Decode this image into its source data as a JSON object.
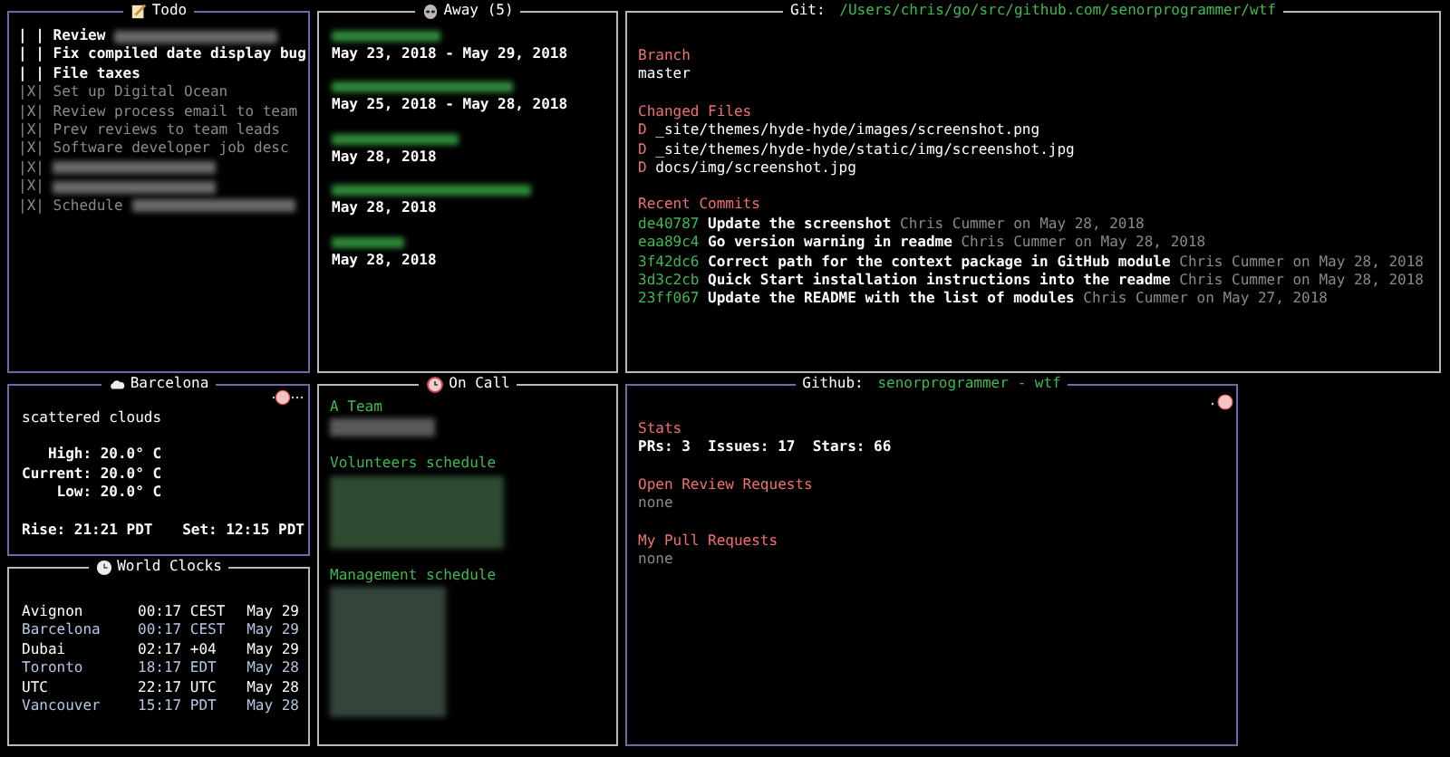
{
  "todo": {
    "title": "Todo",
    "focusable": true,
    "items": [
      {
        "box": "| |",
        "text": "Review",
        "checked": false,
        "redacted": true
      },
      {
        "box": "| |",
        "text": "Fix compiled date display bug",
        "checked": false,
        "redacted": false
      },
      {
        "box": "| |",
        "text": "File taxes",
        "checked": false,
        "redacted": false
      },
      {
        "box": "|X|",
        "text": "Set up Digital Ocean",
        "checked": true,
        "redacted": false
      },
      {
        "box": "|X|",
        "text": "Review process email to team",
        "checked": true,
        "redacted": false
      },
      {
        "box": "|X|",
        "text": "Prev reviews to team leads",
        "checked": true,
        "redacted": false
      },
      {
        "box": "|X|",
        "text": "Software developer job desc",
        "checked": true,
        "redacted": false
      },
      {
        "box": "|X|",
        "checked": true,
        "redacted": true
      },
      {
        "box": "|X|",
        "checked": true,
        "redacted": true
      },
      {
        "box": "|X|",
        "text": "Schedule",
        "checked": true,
        "redacted": true
      }
    ]
  },
  "away": {
    "title": "Away (5)",
    "focusable": false,
    "entries": [
      {
        "date": "May 23, 2018 - May 29, 2018"
      },
      {
        "date": "May 25, 2018 - May 28, 2018"
      },
      {
        "date": "May 28, 2018"
      },
      {
        "date": "May 28, 2018"
      },
      {
        "date": "May 28, 2018"
      }
    ]
  },
  "git": {
    "title": "Git:",
    "path": "/Users/chris/go/src/github.com/senorprogrammer/wtf",
    "focusable": false,
    "branch_heading": "Branch",
    "branch": "master",
    "changed_heading": "Changed Files",
    "changed_files": [
      {
        "status": "D",
        "path": "_site/themes/hyde-hyde/images/screenshot.png"
      },
      {
        "status": "D",
        "path": "_site/themes/hyde-hyde/static/img/screenshot.jpg"
      },
      {
        "status": "D",
        "path": "docs/img/screenshot.jpg"
      }
    ],
    "commits_heading": "Recent Commits",
    "commits": [
      {
        "hash": "de40787",
        "message": "Update the screenshot",
        "author": "Chris Cummer on May 28, 2018"
      },
      {
        "hash": "eaa89c4",
        "message": "Go version warning in readme",
        "author": "Chris Cummer on May 28, 2018"
      },
      {
        "hash": "3f42dc6",
        "message": "Correct path for the context package in GitHub module",
        "author": "Chris Cummer on May 28, 2018"
      },
      {
        "hash": "3d3c2cb",
        "message": "Quick Start installation instructions into the readme",
        "author": "Chris Cummer on May 28, 2018"
      },
      {
        "hash": "23ff067",
        "message": "Update the README with the list of modules",
        "author": "Chris Cummer on May 27, 2018"
      }
    ]
  },
  "weather": {
    "title": "Barcelona",
    "focusable": true,
    "description": "scattered clouds",
    "readings": [
      "   High: 20.0° C",
      "Current: 20.0° C",
      "    Low: 20.0° C"
    ],
    "sunrise": "Rise: 21:21 PDT",
    "sunset": "Set: 12:15 PDT"
  },
  "world_clocks": {
    "title": "World Clocks",
    "focusable": false,
    "rows": [
      {
        "city": "Avignon",
        "time": "00:17 CEST",
        "date": "May 29"
      },
      {
        "city": "Barcelona",
        "time": "00:17 CEST",
        "date": "May 29"
      },
      {
        "city": "Dubai",
        "time": "02:17 +04",
        "date": "May 29"
      },
      {
        "city": "Toronto",
        "time": "18:17 EDT",
        "date": "May 28"
      },
      {
        "city": "UTC",
        "time": "22:17 UTC",
        "date": "May 28"
      },
      {
        "city": "Vancouver",
        "time": "15:17 PDT",
        "date": "May 28"
      }
    ]
  },
  "on_call": {
    "title": "On Call",
    "focusable": false,
    "schedules": [
      {
        "name": "A Team"
      },
      {
        "name": "Volunteers schedule"
      },
      {
        "name": "Management schedule"
      }
    ]
  },
  "github": {
    "title": "Github:",
    "repo": "senorprogrammer - wtf",
    "focusable": true,
    "stats_heading": "Stats",
    "stats": "PRs: 3  Issues: 17  Stars: 66",
    "review_heading": "Open Review Requests",
    "review_value": "none",
    "pulls_heading": "My Pull Requests",
    "pulls_value": "none"
  }
}
